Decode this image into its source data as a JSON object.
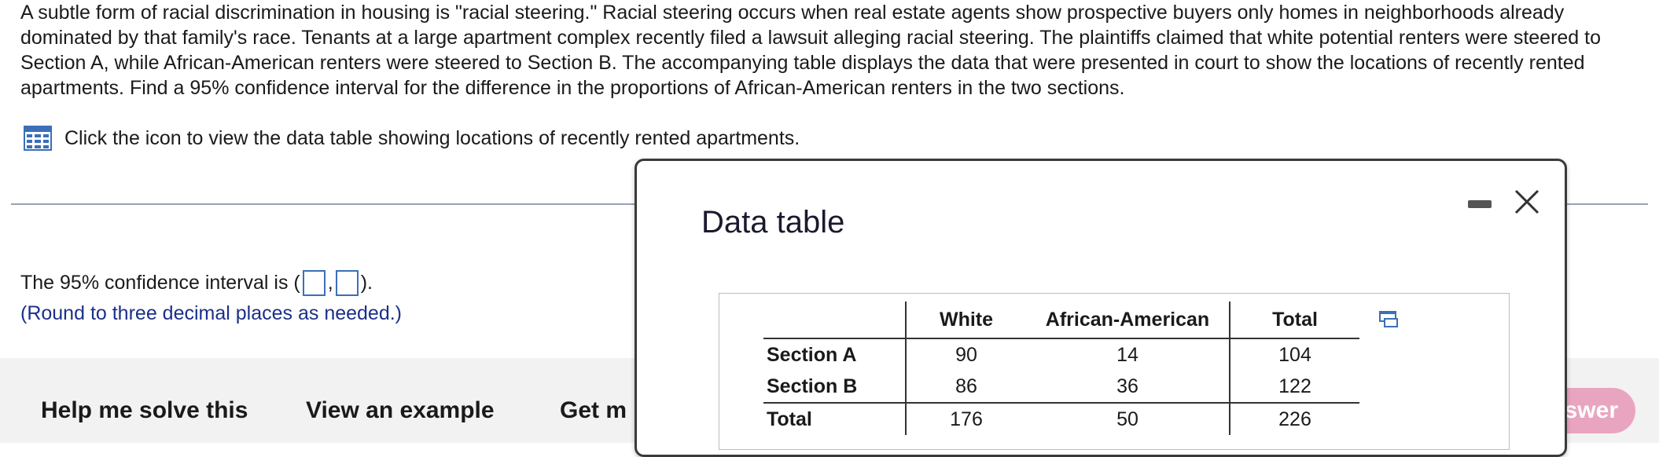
{
  "question": {
    "text": "A subtle form of racial discrimination in housing is \"racial steering.\" Racial steering occurs when real estate agents show prospective buyers only homes in neighborhoods already dominated by that family's race. Tenants at a large apartment complex recently filed a lawsuit alleging racial steering. The plaintiffs claimed that white potential renters were steered to Section A, while African-American renters were steered to Section B. The accompanying table displays the data that were presented in court to show the locations of recently rented apartments. Find a 95% confidence interval for the difference in the proportions of African-American renters in the two sections."
  },
  "data_link": {
    "icon": "table-grid-icon",
    "text": "Click the icon to view the data table showing locations of recently rented apartments."
  },
  "answer": {
    "prefix": "The 95% confidence interval is (",
    "separator": ",",
    "suffix": ").",
    "lower_value": "",
    "upper_value": "",
    "note": "(Round to three decimal places as needed.)"
  },
  "bottom_bar": {
    "help_label": "Help me solve this",
    "example_label": "View an example",
    "more_label": "Get m",
    "check_label": "swer"
  },
  "dialog": {
    "title": "Data table",
    "columns": [
      "",
      "White",
      "African-American",
      "Total"
    ],
    "rows": [
      {
        "label": "Section A",
        "white": "90",
        "african_american": "14",
        "total": "104"
      },
      {
        "label": "Section B",
        "white": "86",
        "african_american": "36",
        "total": "122"
      },
      {
        "label": "Total",
        "white": "176",
        "african_american": "50",
        "total": "226"
      }
    ]
  },
  "colors": {
    "accent_blue": "#3b6fb6",
    "note_blue": "#1b2f8a",
    "check_button_pink": "#e9a5c0",
    "bottom_bar_bg": "#f2f2f2"
  }
}
